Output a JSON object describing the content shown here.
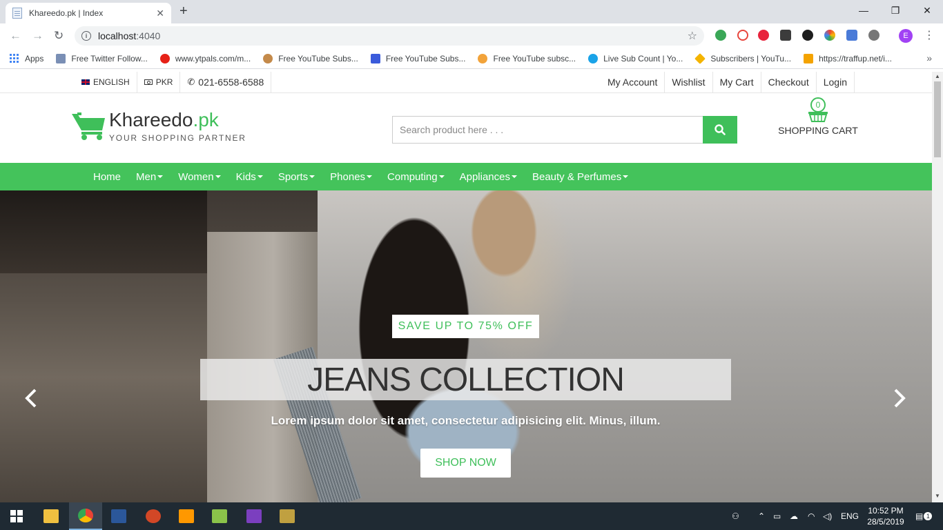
{
  "browser": {
    "tab_title": "Khareedo.pk | Index",
    "new_tab": "+",
    "tab_close": "✕",
    "url_host": "localhost",
    "url_port": ":4040",
    "window_controls": [
      "—",
      "❐",
      "✕"
    ],
    "bookmarks": [
      {
        "label": "Apps",
        "color": "#4285f4"
      },
      {
        "label": "Free Twitter Follow...",
        "color": "#7a8fb5"
      },
      {
        "label": "www.ytpals.com/m...",
        "color": "#e62117"
      },
      {
        "label": "Free YouTube Subs...",
        "color": "#c48a4a"
      },
      {
        "label": "Free YouTube Subs...",
        "color": "#3b5bdb"
      },
      {
        "label": "Free YouTube subsc...",
        "color": "#f2a33a"
      },
      {
        "label": "Live Sub Count | Yo...",
        "color": "#1aa3e8"
      },
      {
        "label": "Subscribers | YouTu...",
        "color": "#f4b400"
      },
      {
        "label": "https://traffup.net/i...",
        "color": "#333333"
      }
    ],
    "bookmarks_more": "»",
    "profile_initial": "E"
  },
  "topbar": {
    "language": "ENGLISH",
    "currency": "PKR",
    "phone": "021-6558-6588",
    "links": [
      "My Account",
      "Wishlist",
      "My Cart",
      "Checkout",
      "Login"
    ]
  },
  "header": {
    "brand_name": "Khareedo",
    "brand_tld": ".pk",
    "tagline": "YOUR SHOPPING PARTNER",
    "search_placeholder": "Search product here . . .",
    "cart_count": "0",
    "cart_label": "SHOPPING CART"
  },
  "nav": {
    "items": [
      "Home",
      "Men",
      "Women",
      "Kids",
      "Sports",
      "Phones",
      "Computing",
      "Appliances",
      "Beauty & Perfumes"
    ]
  },
  "hero": {
    "badge": "SAVE UP TO 75% OFF",
    "headline": "JEANS COLLECTION",
    "subtext": "Lorem ipsum dolor sit amet, consectetur adipisicing elit. Minus, illum.",
    "cta": "SHOP NOW",
    "prev": "‹",
    "next": "›"
  },
  "taskbar": {
    "language": "ENG",
    "time": "10:52 PM",
    "date": "28/5/2019",
    "notifications": "1"
  },
  "colors": {
    "brand_green": "#44c35b",
    "text_dark": "#333333"
  }
}
